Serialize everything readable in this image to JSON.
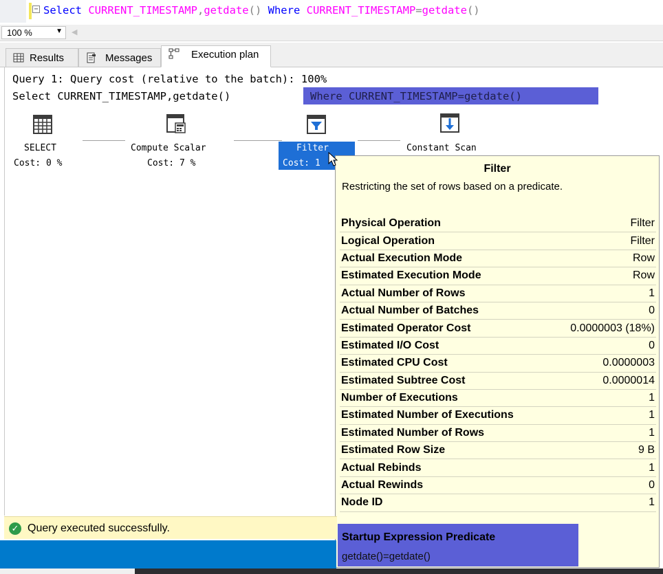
{
  "editor": {
    "tokens": [
      {
        "text": "Select ",
        "cls": "kw"
      },
      {
        "text": "CURRENT_TIMESTAMP",
        "cls": "fn"
      },
      {
        "text": ",",
        "cls": "pl"
      },
      {
        "text": "getdate",
        "cls": "fn"
      },
      {
        "text": "() ",
        "cls": "pl"
      },
      {
        "text": "Where ",
        "cls": "kw"
      },
      {
        "text": "CURRENT_TIMESTAMP",
        "cls": "fn"
      },
      {
        "text": "=",
        "cls": "pl"
      },
      {
        "text": "getdate",
        "cls": "fn"
      },
      {
        "text": "()",
        "cls": "pl"
      }
    ],
    "fold_glyph": "−"
  },
  "zoom": {
    "value": "100 %",
    "arrow": "▼",
    "scroll_arrow": "◀"
  },
  "tabs": {
    "results": "Results",
    "messages": "Messages",
    "execution_plan": "Execution plan",
    "active": "execution_plan"
  },
  "query": {
    "cost_line": "Query 1: Query cost (relative to the batch): 100%",
    "sql_prefix": "Select CURRENT_TIMESTAMP,getdate() ",
    "sql_highlight": "Where CURRENT_TIMESTAMP=getdate()"
  },
  "plan": {
    "nodes": [
      {
        "name": "SELECT",
        "cost": "Cost: 0 %",
        "icon": "select-icon"
      },
      {
        "name": "Compute Scalar",
        "cost": "Cost: 7 %",
        "icon": "compute-scalar-icon"
      },
      {
        "name": "Filter",
        "cost": "Cost: 1",
        "icon": "filter-icon"
      },
      {
        "name": "Constant Scan",
        "cost": "",
        "icon": "constant-scan-icon"
      }
    ],
    "selected": "Filter"
  },
  "tooltip": {
    "title": "Filter",
    "description": "Restricting the set of rows based on a predicate.",
    "rows": [
      {
        "key": "Physical Operation",
        "value": "Filter"
      },
      {
        "key": "Logical Operation",
        "value": "Filter"
      },
      {
        "key": "Actual Execution Mode",
        "value": "Row"
      },
      {
        "key": "Estimated Execution Mode",
        "value": "Row"
      },
      {
        "key": "Actual Number of Rows",
        "value": "1"
      },
      {
        "key": "Actual Number of Batches",
        "value": "0"
      },
      {
        "key": "Estimated Operator Cost",
        "value": "0.0000003 (18%)"
      },
      {
        "key": "Estimated I/O Cost",
        "value": "0"
      },
      {
        "key": "Estimated CPU Cost",
        "value": "0.0000003"
      },
      {
        "key": "Estimated Subtree Cost",
        "value": "0.0000014"
      },
      {
        "key": "Number of Executions",
        "value": "1"
      },
      {
        "key": "Estimated Number of Executions",
        "value": "1"
      },
      {
        "key": "Estimated Number of Rows",
        "value": "1"
      },
      {
        "key": "Estimated Row Size",
        "value": "9 B"
      },
      {
        "key": "Actual Rebinds",
        "value": "1"
      },
      {
        "key": "Actual Rewinds",
        "value": "0"
      },
      {
        "key": "Node ID",
        "value": "1"
      }
    ],
    "predicate_title": "Startup Expression Predicate",
    "predicate_value": "getdate()=getdate()"
  },
  "status": {
    "message": "Query executed successfully.",
    "icon": "check-circle-icon",
    "check": "✓"
  },
  "colors": {
    "keyword": "#0000ff",
    "function": "#ff00ff",
    "highlight": "#5b5fd6",
    "selection": "#1e6fd6",
    "tooltip_bg": "#ffffe1",
    "status_bg": "#fff8c4",
    "ide_blue": "#007acc"
  }
}
